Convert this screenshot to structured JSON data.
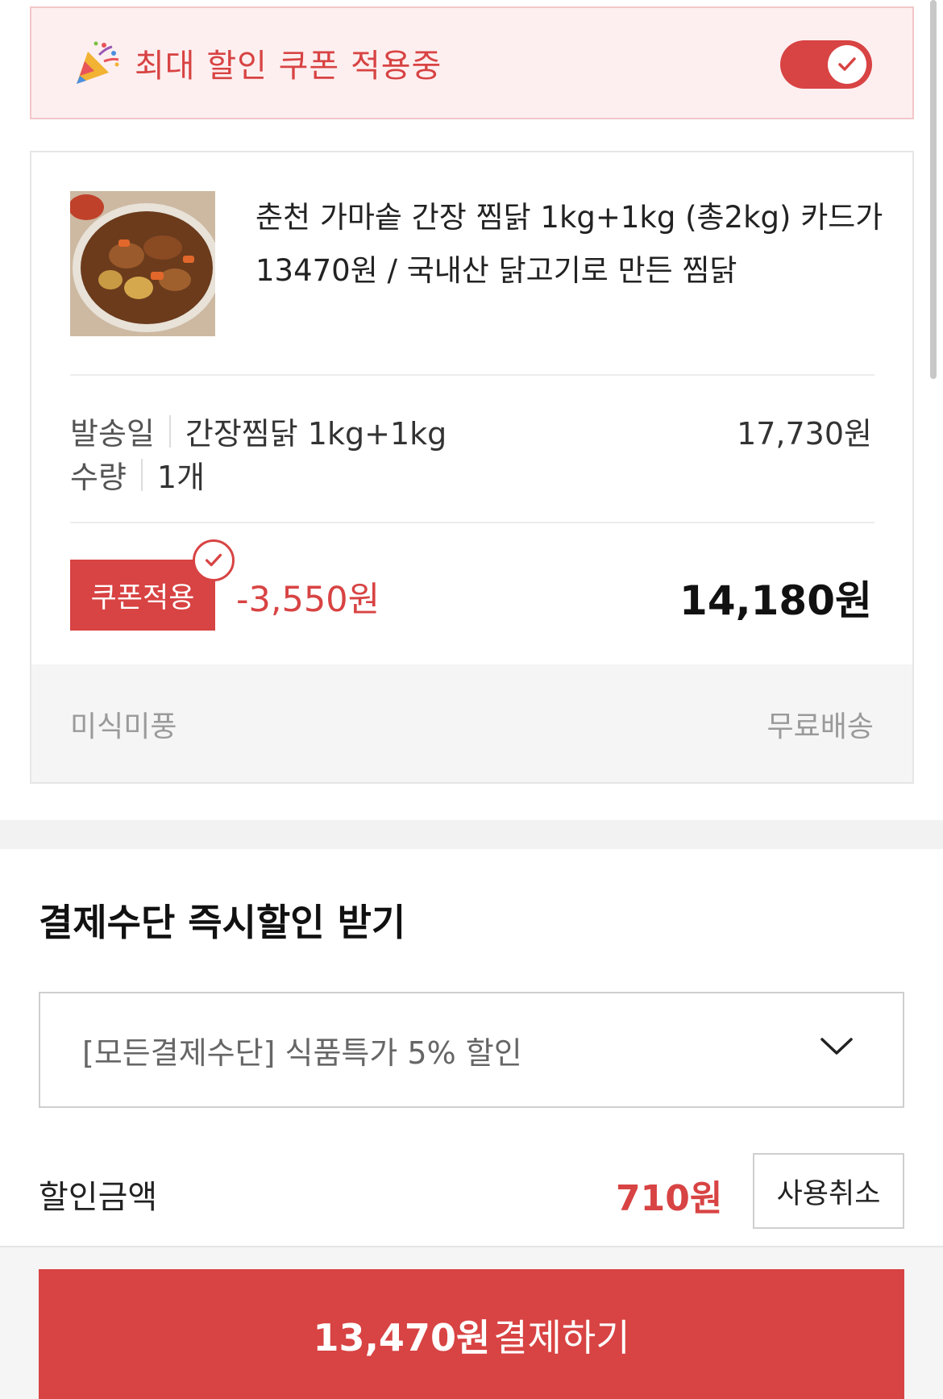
{
  "coupon_banner": {
    "text": "최대 할인 쿠폰 적용중",
    "icon": "party-popper-icon",
    "toggle_on": true
  },
  "product": {
    "title": "춘천 가마솥 간장 찜닭 1kg+1kg (총2kg) 카드가 13470원 / 국내산 닭고기로 만든 찜닭",
    "option_label": "발송일",
    "option_value": "간장찜닭 1kg+1kg",
    "quantity_label": "수량",
    "quantity_value": "1개",
    "option_price": "17,730원",
    "coupon_button": "쿠폰적용",
    "coupon_discount": "-3,550원",
    "final_price": "14,180원",
    "seller": "미식미풍",
    "shipping": "무료배송"
  },
  "payment": {
    "title": "결제수단 즉시할인 받기",
    "selected_option": "[모든결제수단] 식품특가 5% 할인",
    "discount_label": "할인금액",
    "discount_amount": "710원",
    "cancel_label": "사용취소"
  },
  "checkout": {
    "amount": "13,470원",
    "label": "결제하기"
  },
  "colors": {
    "accent": "#d84343",
    "banner_bg": "#fdeff0"
  }
}
